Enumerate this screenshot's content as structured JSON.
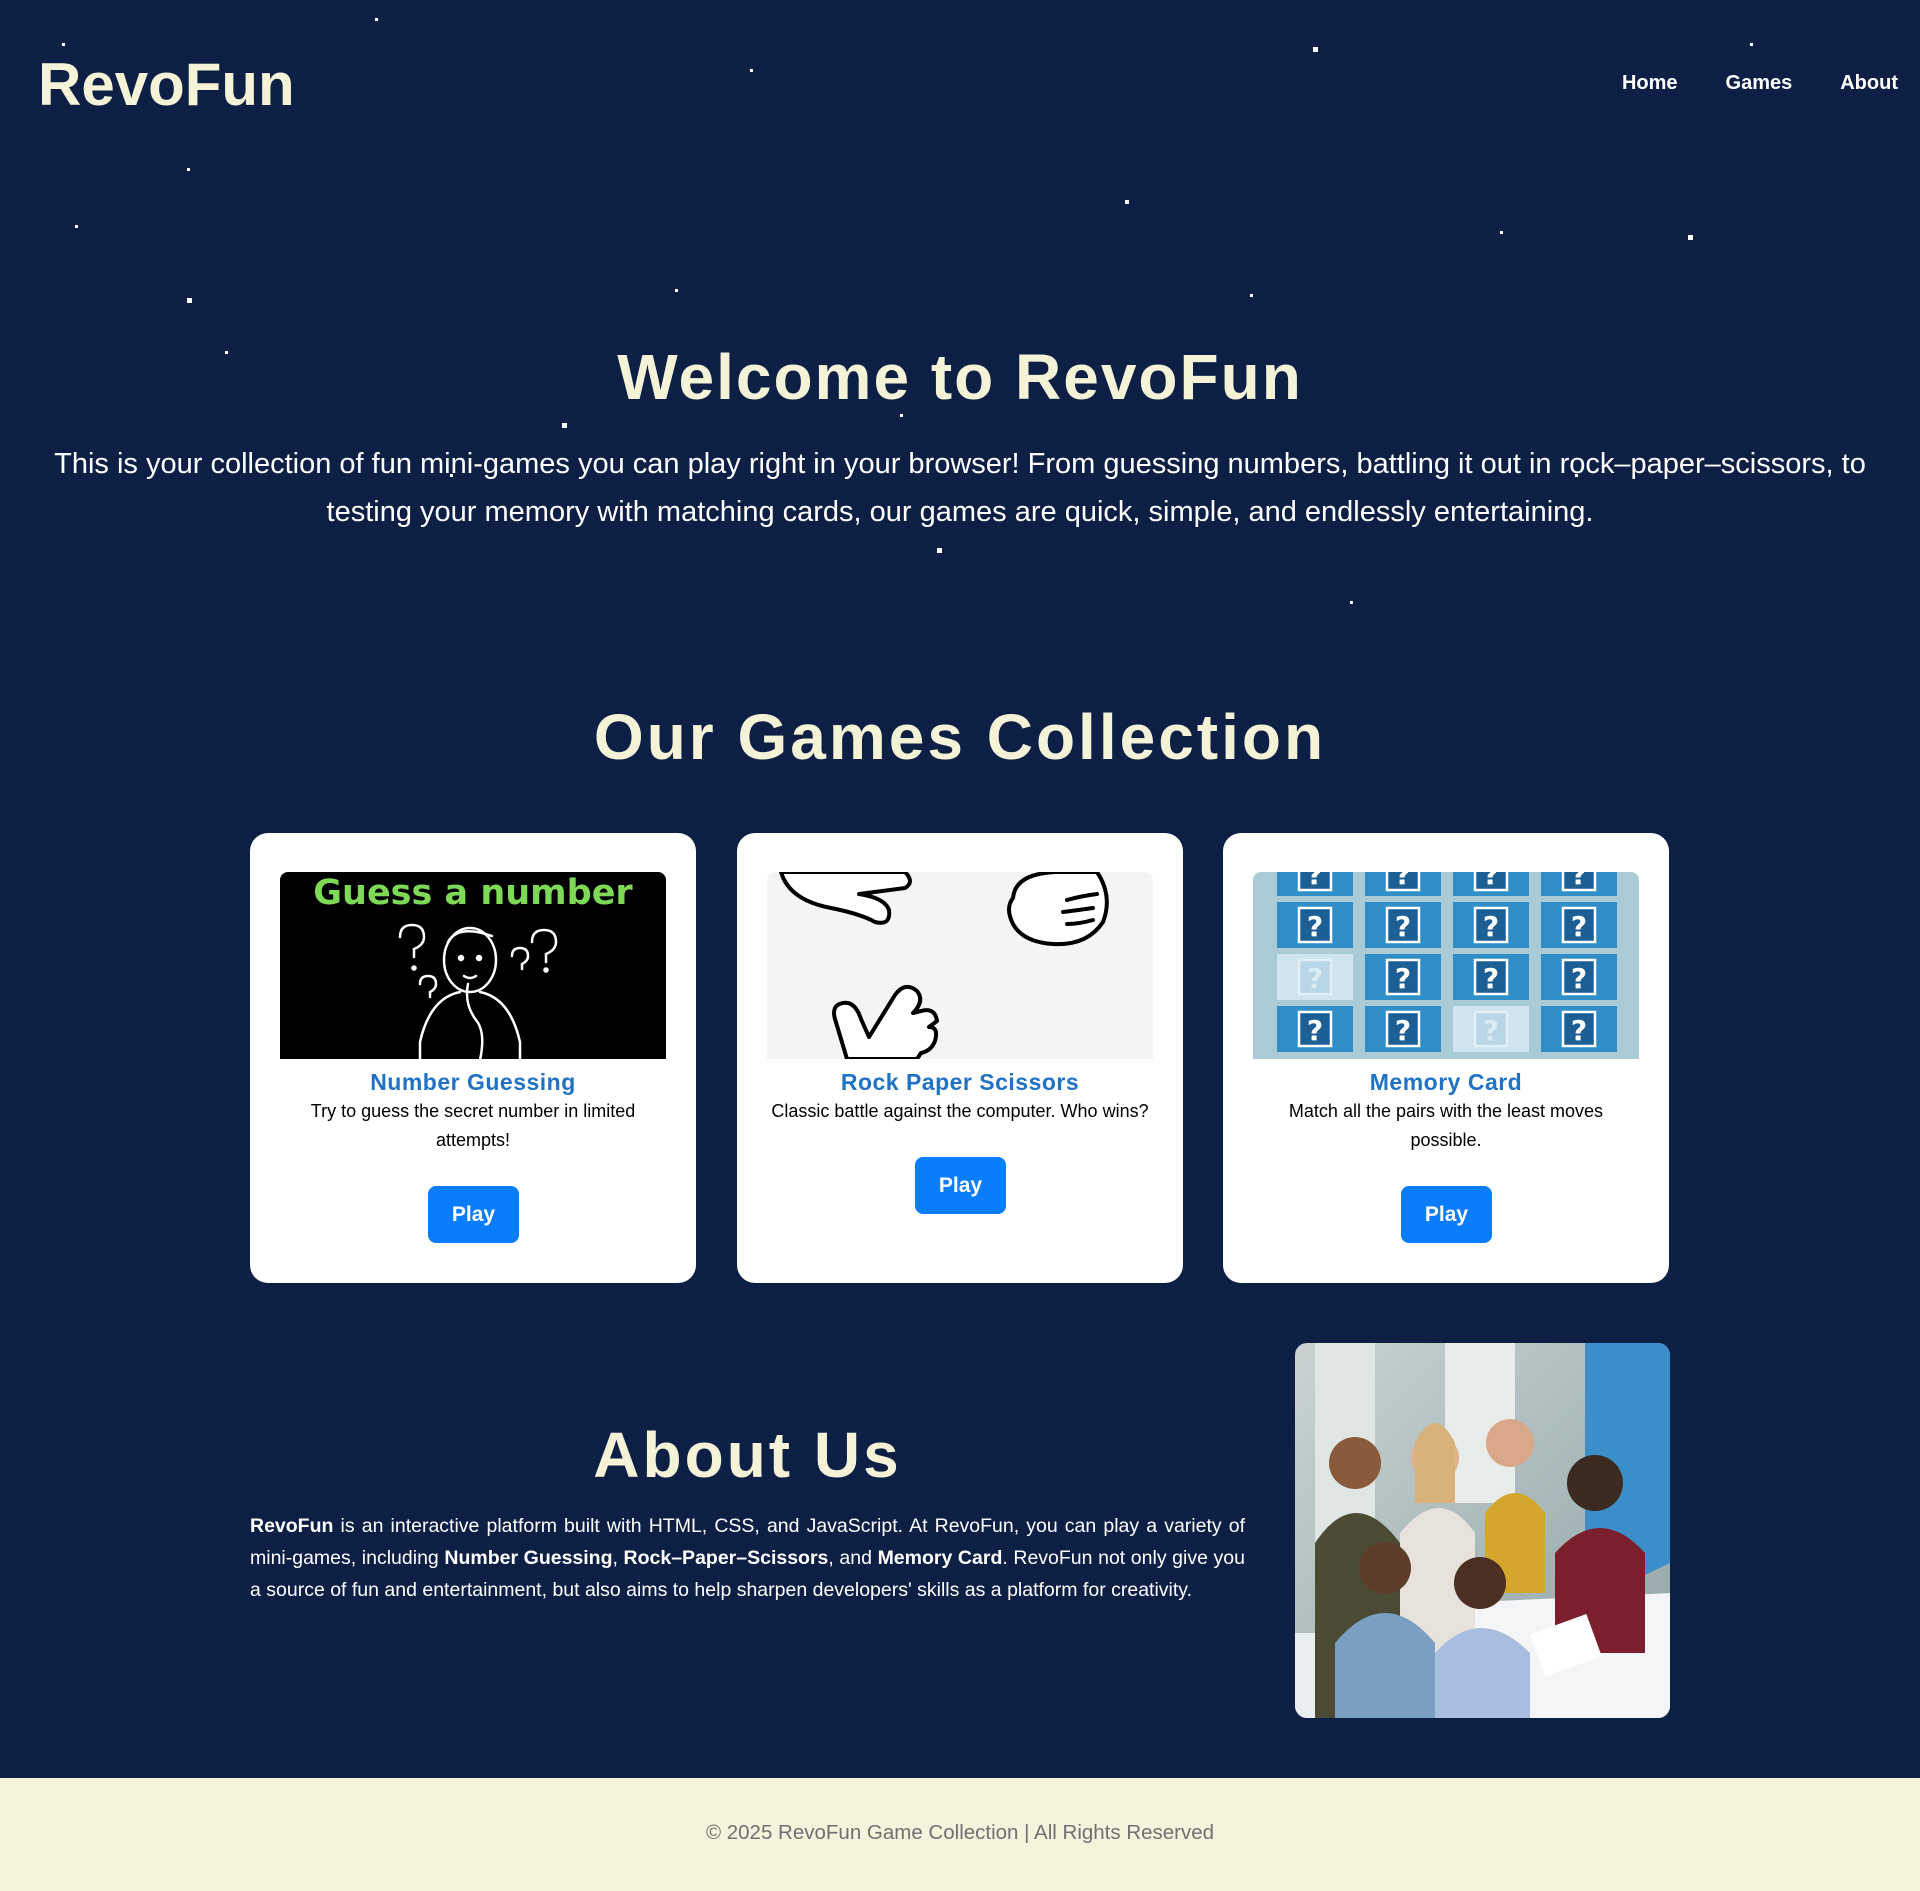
{
  "site": {
    "logo": "RevoFun",
    "nav": [
      {
        "label": "Home"
      },
      {
        "label": "Games"
      },
      {
        "label": "About"
      }
    ]
  },
  "hero": {
    "title": "Welcome to RevoFun",
    "description": "This is your collection of fun mini-games you can play right in your browser! From guessing numbers, battling it out in rock–paper–scissors, to testing your memory with matching cards, our games are quick, simple, and endlessly entertaining."
  },
  "games": {
    "title": "Our Games Collection",
    "cards": [
      {
        "thumb_caption": "Guess a number",
        "title": "Number Guessing",
        "description": "Try to guess the secret number in limited attempts!",
        "button": "Play"
      },
      {
        "title": "Rock Paper Scissors",
        "description": "Classic battle against the computer. Who wins?",
        "button": "Play"
      },
      {
        "title": "Memory Card",
        "description": "Match all the pairs with the least moves possible.",
        "button": "Play"
      }
    ]
  },
  "about": {
    "title": "About Us",
    "brand": "RevoFun",
    "text_1": " is an interactive platform built with HTML, CSS, and JavaScript. At RevoFun, you can play a variety of mini-games, including ",
    "game_1": "Number Guessing",
    "sep_1": ", ",
    "game_2": "Rock–Paper–Scissors",
    "sep_2": ", and ",
    "game_3": "Memory Card",
    "text_2": ". RevoFun not only give you a source of fun and entertainment, but also aims to help sharpen developers' skills as a platform for creativity."
  },
  "footer": {
    "text": "© 2025 RevoFun Game Collection | All Rights Reserved"
  },
  "colors": {
    "background": "#0d1f45",
    "heading": "#f5f3d7",
    "accent_button": "#0a7dfc",
    "card_title": "#1f72c4",
    "footer_bg": "#f5f3dc",
    "footer_text": "#707070"
  }
}
